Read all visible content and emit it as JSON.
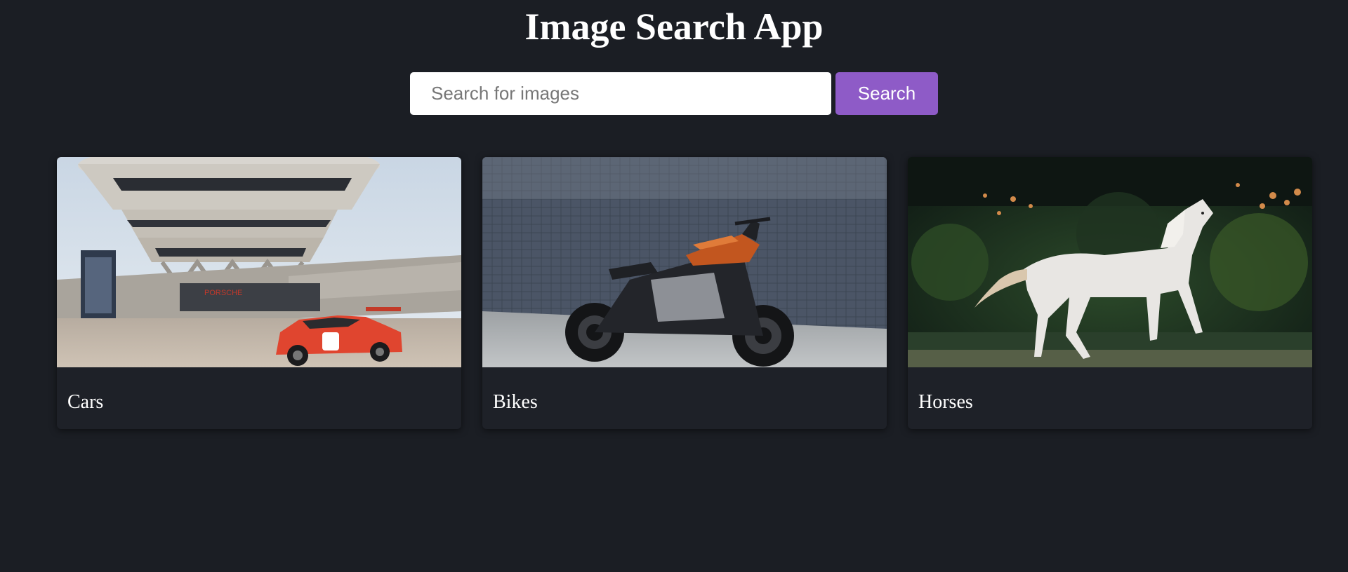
{
  "header": {
    "title": "Image Search App"
  },
  "search": {
    "placeholder": "Search for images",
    "value": "",
    "button_label": "Search"
  },
  "results": [
    {
      "label": "Cars",
      "image": "photo of a red and white race car parked in front of a round modern building"
    },
    {
      "label": "Bikes",
      "image": "photo of a black and orange motorcycle in front of a tiled wall"
    },
    {
      "label": "Horses",
      "image": "photo of a white horse running in front of dark foliage"
    }
  ],
  "colors": {
    "background": "#1b1e24",
    "card_background": "#1e2128",
    "accent": "#8e5bc7"
  }
}
